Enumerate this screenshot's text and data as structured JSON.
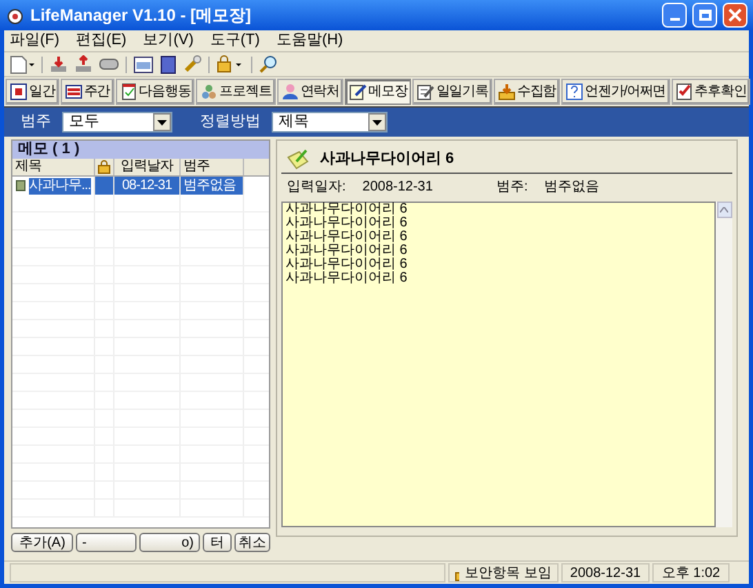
{
  "window": {
    "title": "LifeManager V1.10 - [메모장]"
  },
  "menu": [
    "파일(F)",
    "편집(E)",
    "보기(V)",
    "도구(T)",
    "도움말(H)"
  ],
  "tabs": [
    {
      "label": "일간",
      "selected": false
    },
    {
      "label": "주간",
      "selected": false
    },
    {
      "label": "다음행동",
      "selected": false
    },
    {
      "label": "프로젝트",
      "selected": false
    },
    {
      "label": "연락처",
      "selected": false
    },
    {
      "label": "메모장",
      "selected": true
    },
    {
      "label": "일일기록",
      "selected": false
    },
    {
      "label": "수집함",
      "selected": false
    },
    {
      "label": "언젠가/어쩌면",
      "selected": false
    },
    {
      "label": "추후확인",
      "selected": false
    }
  ],
  "filter": {
    "category_label": "범주",
    "category": "모두",
    "sort_label": "정렬방법",
    "sort": "제목"
  },
  "memo_list": {
    "header": "메모 ( 1 )",
    "columns": [
      "제목",
      "입력날자",
      "범주"
    ],
    "rows": [
      {
        "cells": [
          "사과나무...",
          "08-12-31",
          "범주없음"
        ],
        "selected": true
      }
    ]
  },
  "memo": {
    "title": "사과나무다이어리 6",
    "date_label": "입력일자:",
    "date": "2008-12-31",
    "category_label": "범주:",
    "category": "범주없음",
    "body": [
      "사과나무다이어리 6",
      "사과나무다이어리 6",
      "사과나무다이어리 6",
      "사과나무다이어리 6",
      "사과나무다이어리 6",
      "사과나무다이어리 6"
    ]
  },
  "buttons": [
    "추가(A)",
    "-",
    "o)",
    "터",
    "취소"
  ],
  "status_bar": {
    "security": "보안항목 보임",
    "date": "2008-12-31",
    "time": "오후 1:02"
  }
}
